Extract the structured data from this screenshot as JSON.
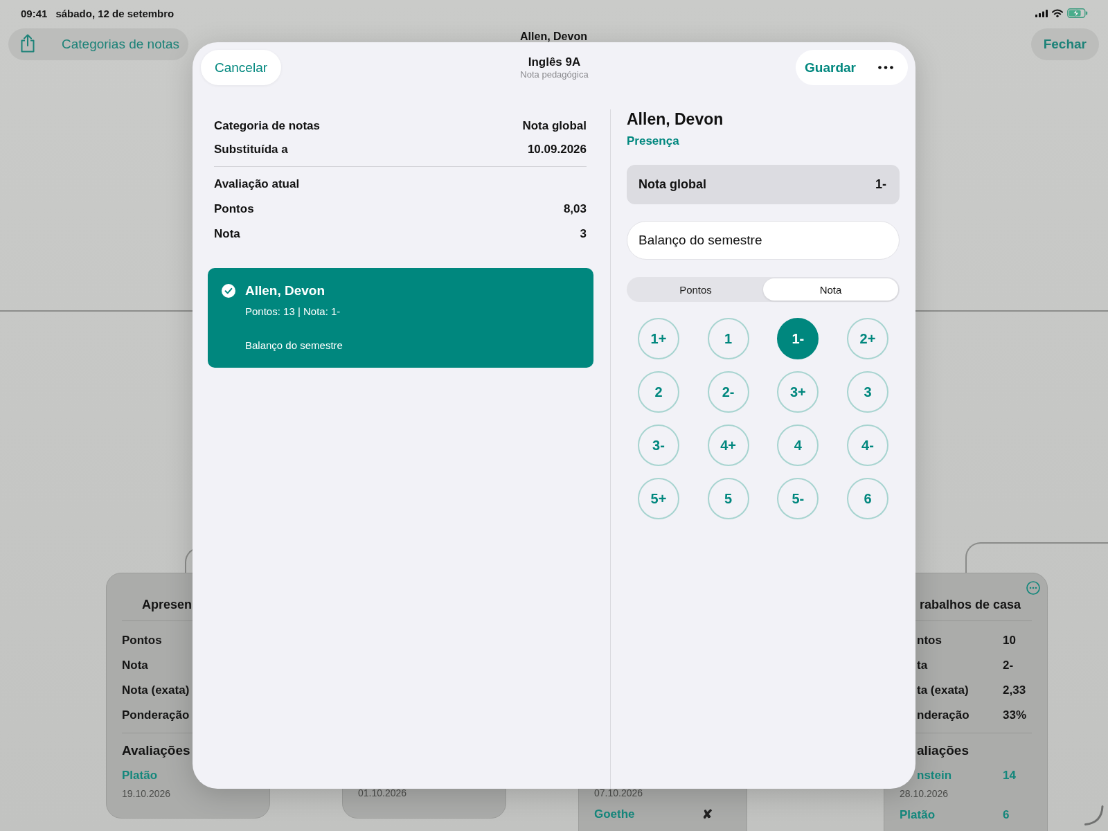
{
  "status_bar": {
    "time": "09:41",
    "date": "sábado, 12 de setembro"
  },
  "nav_bar": {
    "back_button": "Categorias de notas",
    "title": "Allen, Devon",
    "close_button": "Fechar"
  },
  "background_cards": [
    {
      "stacked": true,
      "title": "Apresen",
      "stats": [
        {
          "label": "Pontos"
        },
        {
          "label": "Nota"
        },
        {
          "label": "Nota (exata)"
        },
        {
          "label": "Ponderação"
        }
      ],
      "section": "Avaliações",
      "evaluations": [
        {
          "name": "Platão",
          "date": "19.10.2026"
        }
      ]
    },
    {
      "evaluations": [
        {
          "date": "01.10.2026"
        }
      ]
    },
    {
      "evaluations": [
        {
          "date": "07.10.2026"
        },
        {
          "name": "Goethe",
          "mark": "✘"
        }
      ]
    },
    {
      "stacked": true,
      "more_button": true,
      "title": "rabalhos de casa",
      "stats": [
        {
          "label": "ntos",
          "value": "10"
        },
        {
          "label": "ta",
          "value": "2-"
        },
        {
          "label": "ta (exata)",
          "value": "2,33"
        },
        {
          "label": "nderação",
          "value": "33%"
        }
      ],
      "section": "aliações",
      "evaluations": [
        {
          "name": "nstein",
          "value": "14",
          "date": "28.10.2026"
        },
        {
          "name": "Platão",
          "value": "6"
        }
      ]
    }
  ],
  "modal": {
    "cancel_button": "Cancelar",
    "title": "Inglês 9A",
    "subtitle": "Nota pedagógica",
    "save_button": "Guardar",
    "details": [
      {
        "label": "Categoria de notas",
        "value": "Nota global"
      },
      {
        "label": "Substituída a",
        "value": "10.09.2026"
      }
    ],
    "current_heading": "Avaliação atual",
    "current": [
      {
        "label": "Pontos",
        "value": "8,03"
      },
      {
        "label": "Nota",
        "value": "3"
      }
    ],
    "entries": [
      {
        "name": "Allen, Devon",
        "summary": "Pontos: 13 | Nota: 1-",
        "comment": "Balanço do semestre",
        "selected": true
      }
    ],
    "student": {
      "name": "Allen, Devon",
      "link": "Presença"
    },
    "category": {
      "label": "Nota global",
      "value": "1-"
    },
    "comment_field": {
      "value": "Balanço do semestre"
    },
    "mode_tabs": [
      {
        "label": "Pontos",
        "selected": false
      },
      {
        "label": "Nota",
        "selected": true
      }
    ],
    "grades": [
      {
        "label": "1+",
        "selected": false
      },
      {
        "label": "1",
        "selected": false
      },
      {
        "label": "1-",
        "selected": true
      },
      {
        "label": "2+",
        "selected": false
      },
      {
        "label": "2",
        "selected": false
      },
      {
        "label": "2-",
        "selected": false
      },
      {
        "label": "3+",
        "selected": false
      },
      {
        "label": "3",
        "selected": false
      },
      {
        "label": "3-",
        "selected": false
      },
      {
        "label": "4+",
        "selected": false
      },
      {
        "label": "4",
        "selected": false
      },
      {
        "label": "4-",
        "selected": false
      },
      {
        "label": "5+",
        "selected": false
      },
      {
        "label": "5",
        "selected": false
      },
      {
        "label": "5-",
        "selected": false
      },
      {
        "label": "6",
        "selected": false
      }
    ]
  }
}
